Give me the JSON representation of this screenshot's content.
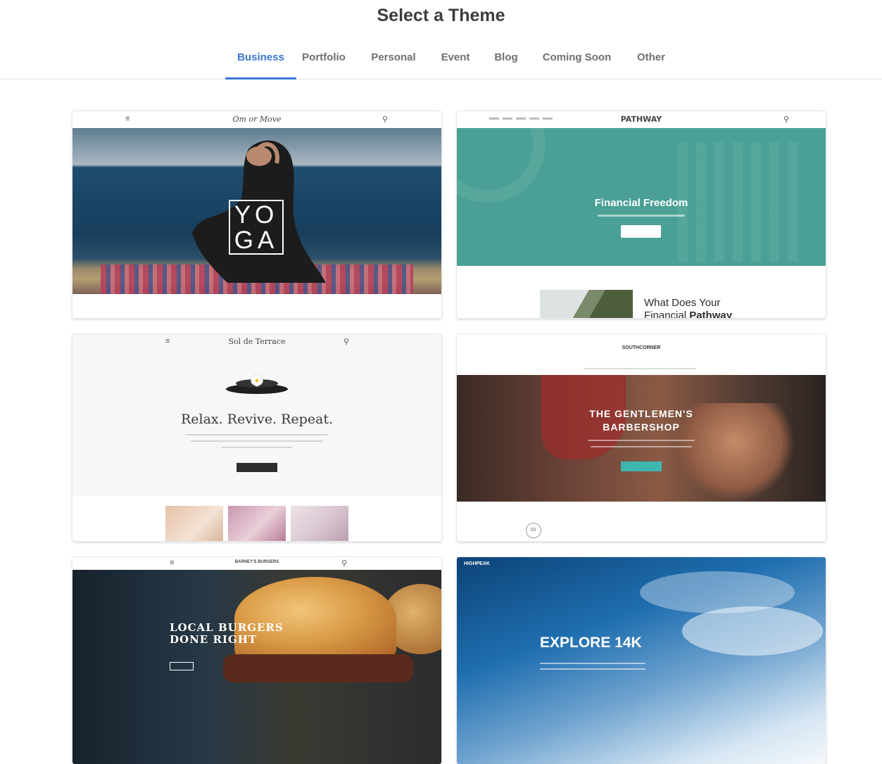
{
  "page_title": "Select a Theme",
  "tabs": [
    {
      "label": "Business",
      "active": true
    },
    {
      "label": "Portfolio",
      "active": false
    },
    {
      "label": "Personal",
      "active": false
    },
    {
      "label": "Event",
      "active": false
    },
    {
      "label": "Blog",
      "active": false
    },
    {
      "label": "Coming Soon",
      "active": false
    },
    {
      "label": "Other",
      "active": false
    }
  ],
  "accent_color": "#3a77d6",
  "themes": [
    {
      "logo": "Om or Move",
      "hero_text_1": "YO",
      "hero_text_2": "GA",
      "icons": [
        "menu-icon",
        "search-icon"
      ]
    },
    {
      "logo": "PATHWAY",
      "headline": "Financial Freedom",
      "section_heading_1": "What Does Your",
      "section_heading_2": "Financial ",
      "section_heading_bold": "Pathway"
    },
    {
      "logo": "Sol de Terrace",
      "headline": "Relax. Revive. Repeat."
    },
    {
      "logo": "SOUTHCORNER",
      "headline_1": "THE GENTLEMEN'S",
      "headline_2": "BARBERSHOP",
      "badge": "01"
    },
    {
      "logo": "BARNEY'S BURGERS",
      "headline_1": "LOCAL BURGERS",
      "headline_2": "DONE RIGHT"
    },
    {
      "logo": "HIGHPEAK",
      "headline": "EXPLORE 14K"
    }
  ]
}
